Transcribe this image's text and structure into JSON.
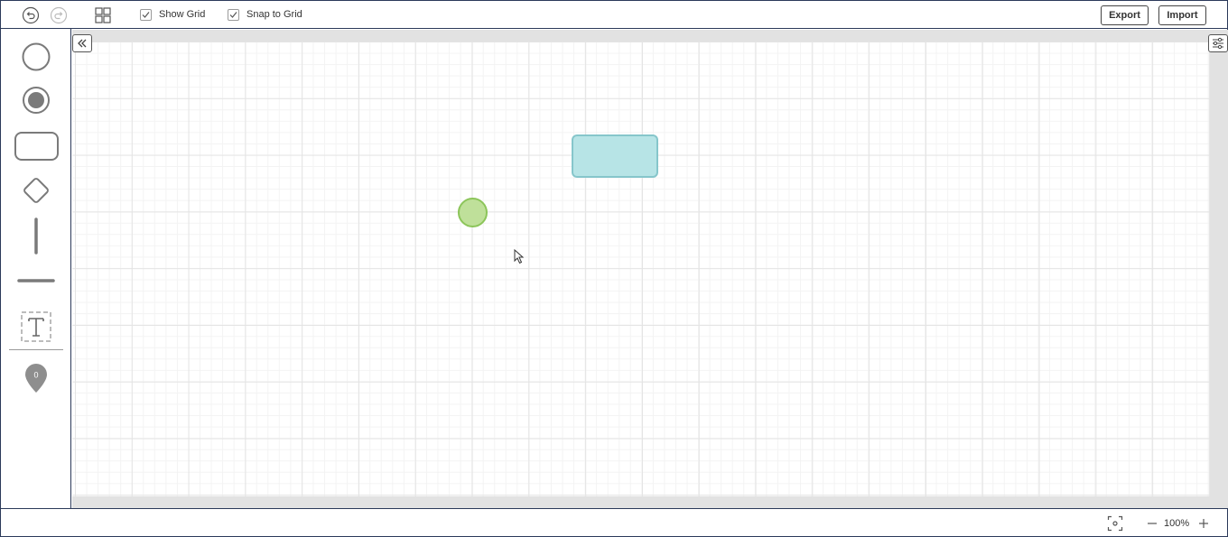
{
  "toolbar": {
    "undo_icon": "undo-icon",
    "redo_icon": "redo-icon",
    "grid_layout_icon": "grid-layout-icon",
    "show_grid": {
      "label": "Show Grid",
      "checked": true
    },
    "snap_to_grid": {
      "label": "Snap to Grid",
      "checked": true
    },
    "export_label": "Export",
    "import_label": "Import"
  },
  "palette": {
    "items": [
      {
        "name": "start-event",
        "icon": "circle-icon"
      },
      {
        "name": "end-event",
        "icon": "filled-circle-icon"
      },
      {
        "name": "task",
        "icon": "rounded-rect-icon"
      },
      {
        "name": "gateway",
        "icon": "diamond-icon"
      },
      {
        "name": "vertical-line",
        "icon": "vertical-line-icon"
      },
      {
        "name": "horizontal-line",
        "icon": "horizontal-line-icon"
      },
      {
        "name": "text",
        "icon": "text-box-icon"
      }
    ],
    "marker": {
      "icon": "map-pin-icon",
      "count": "0"
    }
  },
  "canvas": {
    "shapes": [
      {
        "type": "rounded-rect",
        "fill": "#b7e4e6",
        "stroke": "#86c6cb"
      },
      {
        "type": "circle",
        "fill": "#bfe09a",
        "stroke": "#8cc55a"
      }
    ]
  },
  "statusbar": {
    "fit_icon": "fit-screen-icon",
    "zoom_out_icon": "minus-icon",
    "zoom_level": "100%",
    "zoom_in_icon": "plus-icon"
  },
  "colors": {
    "border": "#2c3a5a",
    "canvas_bg": "#ffffff",
    "canvas_margin": "#e2e2e2",
    "icon_gray": "#7a7a7a"
  }
}
